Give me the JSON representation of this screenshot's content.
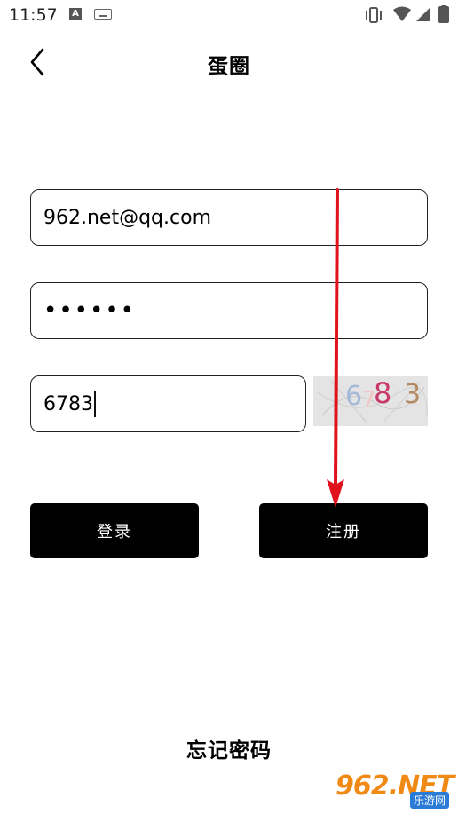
{
  "status_bar": {
    "time": "11:57",
    "notification_badge": "A"
  },
  "header": {
    "title": "蛋圈"
  },
  "form": {
    "email_value": "962.net@qq.com",
    "password_value": "••••••",
    "captcha_value": "6783",
    "captcha_image_text": [
      "6",
      "7",
      "8",
      "3"
    ]
  },
  "buttons": {
    "login_label": "登录",
    "register_label": "注册"
  },
  "footer": {
    "forgot_password_label": "忘记密码"
  },
  "watermark": {
    "main": "962.NET",
    "sub": "乐游网"
  },
  "colors": {
    "button_bg": "#000000",
    "arrow": "#e0121c",
    "watermark_orange": "#f08a14",
    "watermark_blue": "#2a7bd6"
  }
}
